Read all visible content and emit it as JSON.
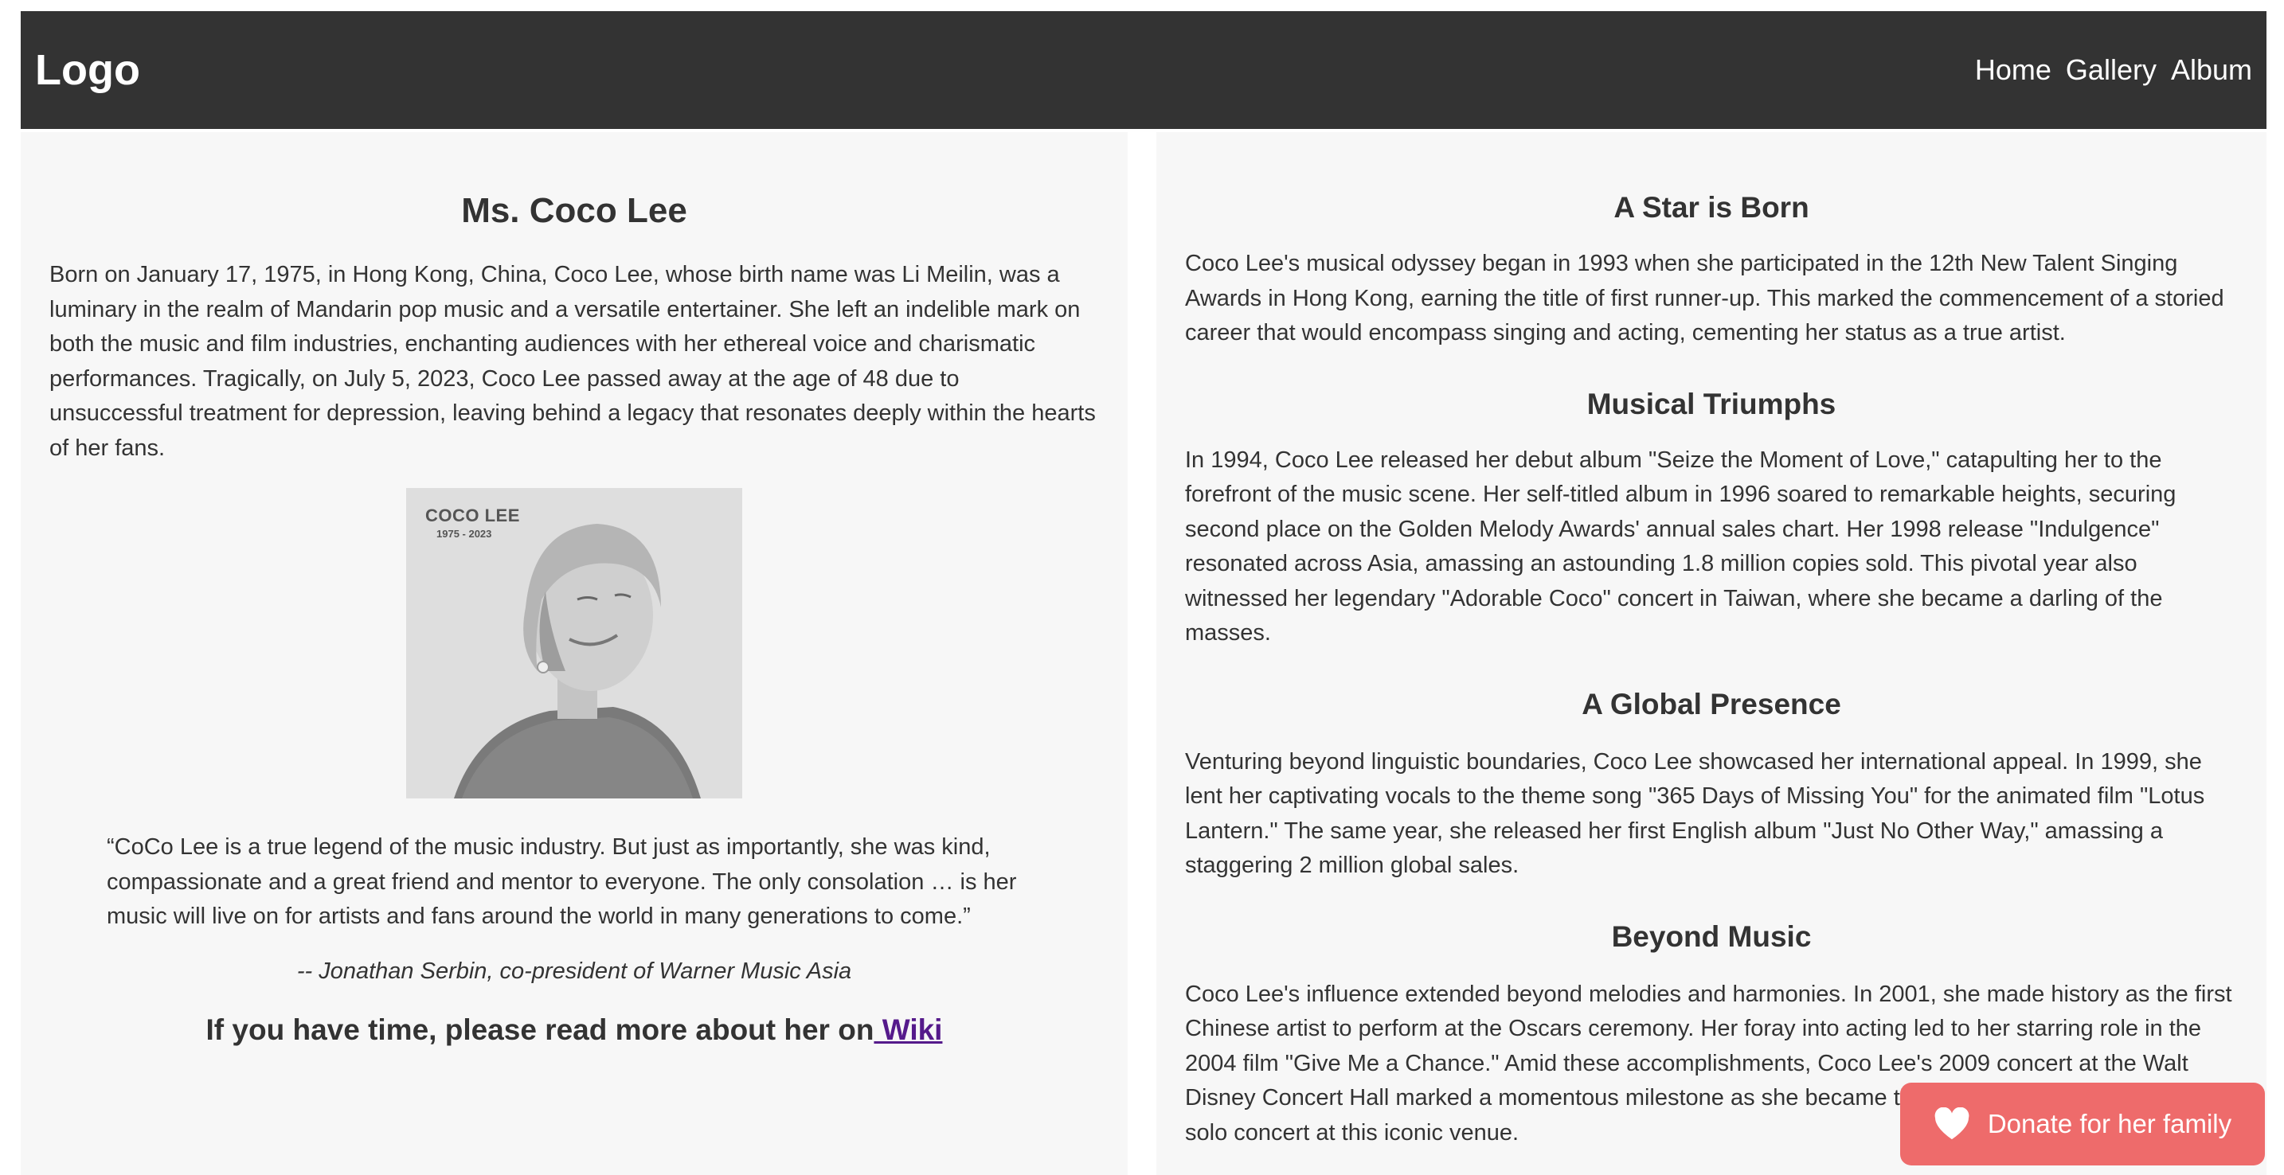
{
  "navbar": {
    "logo": "Logo",
    "links": [
      "Home",
      "Gallery",
      "Album"
    ]
  },
  "left": {
    "title": "Ms. Coco Lee",
    "bio": "Born on January 17, 1975, in Hong Kong, China, Coco Lee, whose birth name was Li Meilin, was a luminary in the realm of Mandarin pop music and a versatile entertainer. She left an indelible mark on both the music and film industries, enchanting audiences with her ethereal voice and charismatic performances. Tragically, on July 5, 2023, Coco Lee passed away at the age of 48 due to unsuccessful treatment for depression, leaving behind a legacy that resonates deeply within the hearts of her fans.",
    "photo": {
      "caption_name": "COCO LEE",
      "caption_years": "1975 - 2023"
    },
    "quote": "“CoCo Lee is a true legend of the music industry. But just as importantly, she was kind, compassionate and a great friend and mentor to everyone. The only consolation … is her music will live on for artists and fans around the world in many generations to come.”",
    "attribution": "-- Jonathan Serbin, co-president of Warner Music Asia",
    "wiki_prefix": "If you have time, please read more about her on",
    "wiki_link": " Wiki"
  },
  "right": {
    "sections": [
      {
        "title": "A Star is Born",
        "text": "Coco Lee's musical odyssey began in 1993 when she participated in the 12th New Talent Singing Awards in Hong Kong, earning the title of first runner-up. This marked the commencement of a storied career that would encompass singing and acting, cementing her status as a true artist."
      },
      {
        "title": "Musical Triumphs",
        "text": "In 1994, Coco Lee released her debut album \"Seize the Moment of Love,\" catapulting her to the forefront of the music scene. Her self-titled album in 1996 soared to remarkable heights, securing second place on the Golden Melody Awards' annual sales chart. Her 1998 release \"Indulgence\" resonated across Asia, amassing an astounding 1.8 million copies sold. This pivotal year also witnessed her legendary \"Adorable Coco\" concert in Taiwan, where she became a darling of the masses."
      },
      {
        "title": "A Global Presence",
        "text": "Venturing beyond linguistic boundaries, Coco Lee showcased her international appeal. In 1999, she lent her captivating vocals to the theme song \"365 Days of Missing You\" for the animated film \"Lotus Lantern.\" The same year, she released her first English album \"Just No Other Way,\" amassing a staggering 2 million global sales."
      },
      {
        "title": "Beyond Music",
        "text": "Coco Lee's influence extended beyond melodies and harmonies. In 2001, she made history as the first Chinese artist to perform at the Oscars ceremony. Her foray into acting led to her starring role in the 2004 film \"Give Me a Chance.\" Amid these accomplishments, Coco Lee's 2009 concert at the Walt Disney Concert Hall marked a momentous milestone as she became the first Chinese singer to hold a solo concert at this iconic venue."
      }
    ]
  },
  "donate": {
    "label": "Donate for her family",
    "icon": "heart-icon",
    "color": "#ee6b6b"
  },
  "colors": {
    "navbar_bg": "#333333",
    "panel_bg": "#f7f7f7",
    "link": "#551a8b"
  }
}
